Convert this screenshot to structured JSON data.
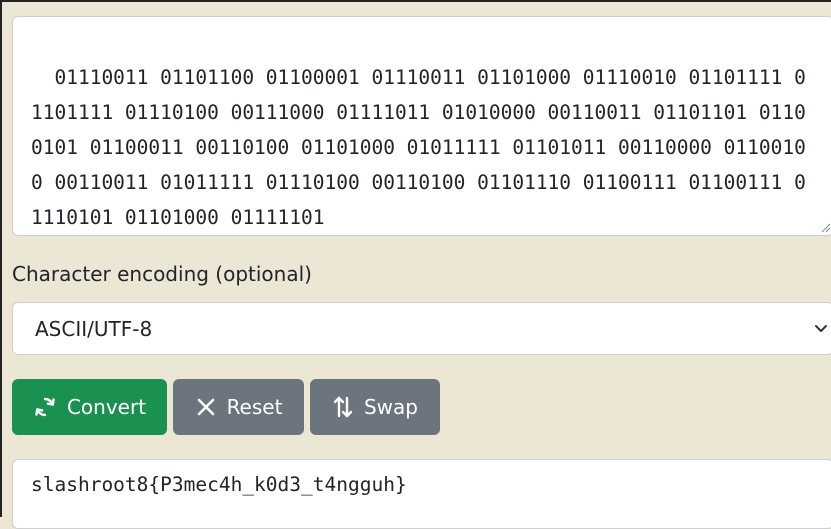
{
  "input": {
    "value": "01110011 01101100 01100001 01110011 01101000 01110010 01101111 01101111 01110100 00111000 01111011 01010000 00110011 01101101 01100101 01100011 00110100 01101000 01011111 01101011 00110000 01100100 00110011 01011111 01110100 00110100 01101110 01100111 01100111 01110101 01101000 01111101"
  },
  "encoding": {
    "label": "Character encoding (optional)",
    "selected": "ASCII/UTF-8"
  },
  "buttons": {
    "convert": "Convert",
    "reset": "Reset",
    "swap": "Swap"
  },
  "output": {
    "value": "slashroot8{P3mec4h_k0d3_t4ngguh}"
  },
  "icons": {
    "convert": "refresh-icon",
    "reset": "close-icon",
    "swap": "swap-vertical-icon",
    "select": "chevron-down-icon"
  },
  "colors": {
    "background": "#ece6d5",
    "convert_button": "#1a9150",
    "secondary_button": "#6c757d"
  }
}
